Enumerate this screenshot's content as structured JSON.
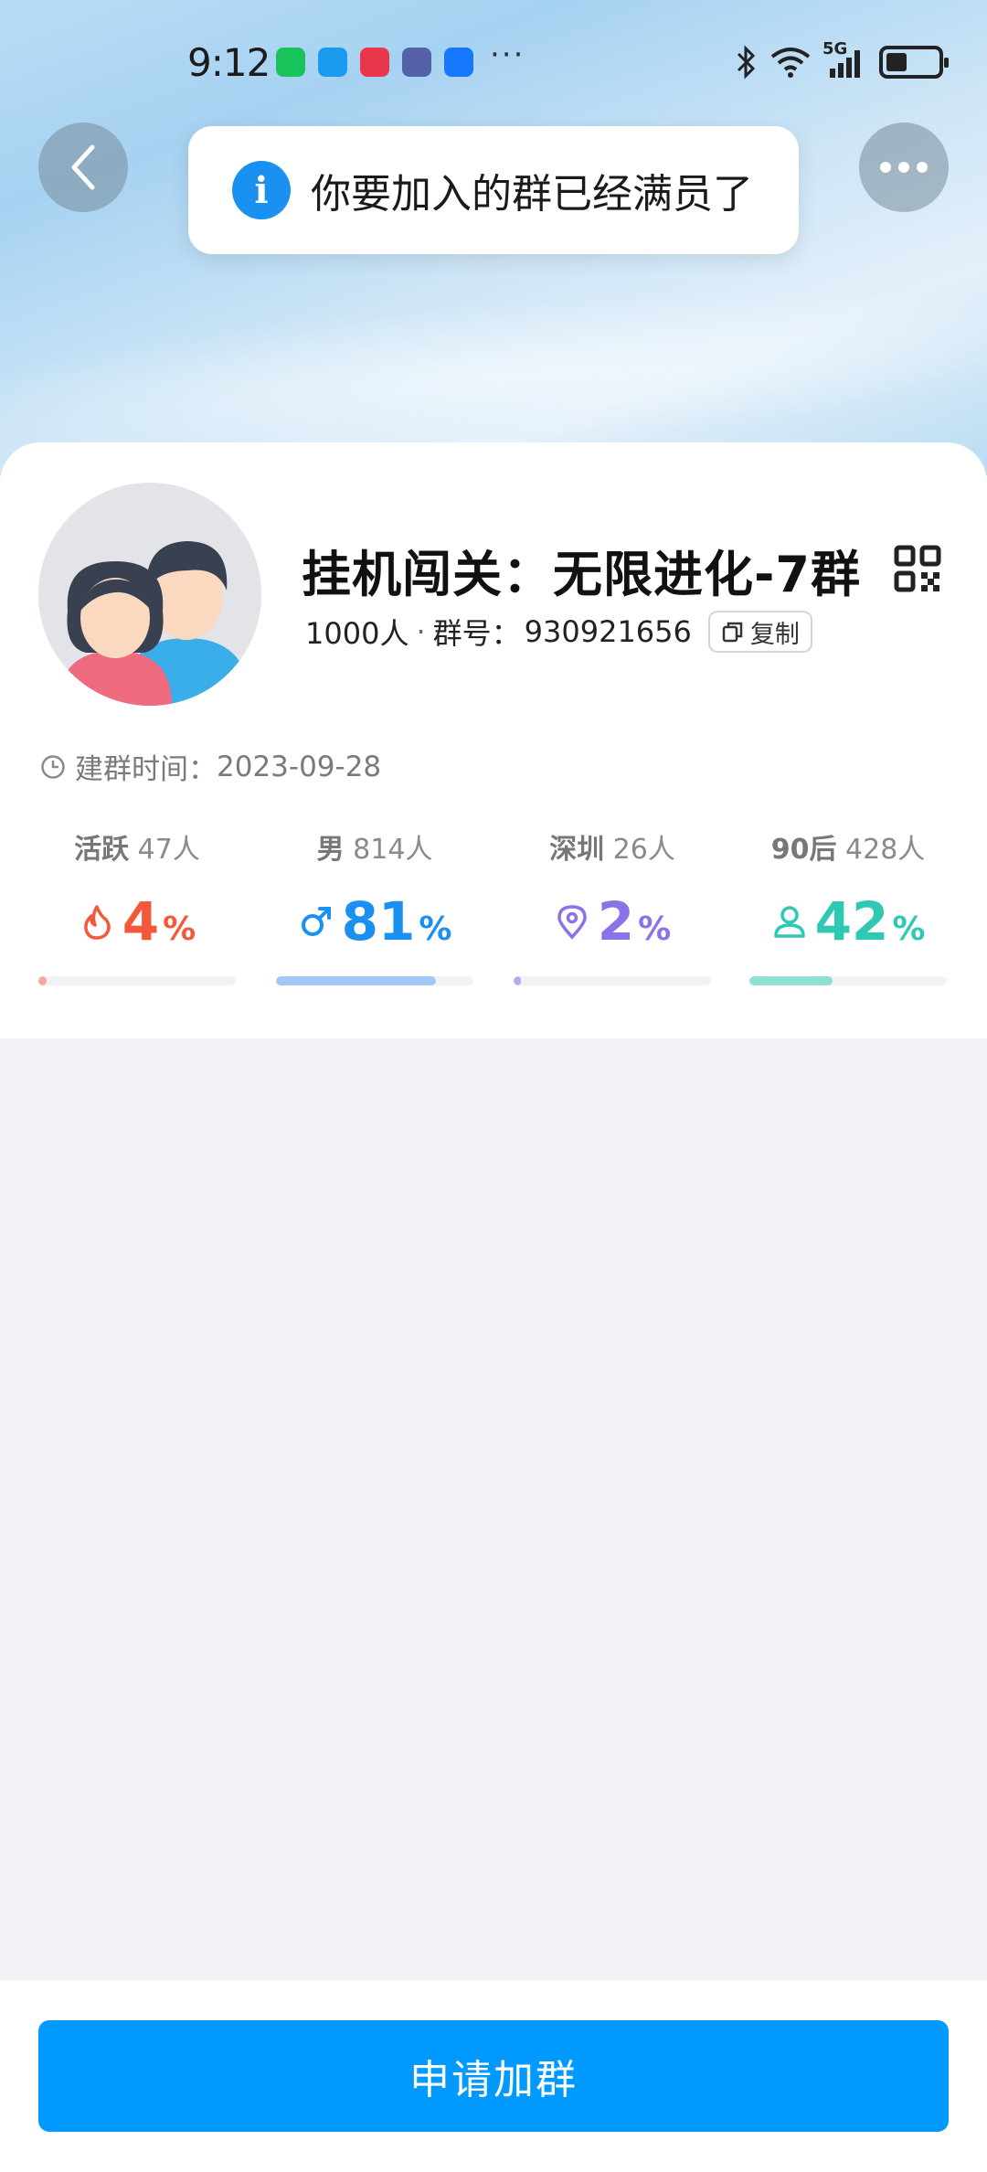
{
  "status_bar": {
    "time": "9:12",
    "dots": "···",
    "network": "5G",
    "app_icons": [
      "wechat-icon",
      "messages-icon",
      "red-app-icon",
      "aqara-icon",
      "alipay-icon"
    ]
  },
  "toast": {
    "message": "你要加入的群已经满员了"
  },
  "group": {
    "name": "挂机闯关：无限进化-7群",
    "members": "1000人",
    "separator": "·",
    "id_label": "群号：",
    "id": "930921656",
    "copy_label": "复制",
    "created_label": "建群时间：",
    "created_date": "2023-09-28"
  },
  "stats": [
    {
      "label": "活跃",
      "count": "47人",
      "value": "4",
      "percent": "%",
      "fraction": 0.04,
      "color": "#f4583a",
      "bar_color": "#f7a89a",
      "icon": "fire-icon"
    },
    {
      "label": "男",
      "count": "814人",
      "value": "81",
      "percent": "%",
      "fraction": 0.81,
      "color": "#1a90f0",
      "bar_color": "#a4c8f5",
      "icon": "male-icon"
    },
    {
      "label": "深圳",
      "count": "26人",
      "value": "2",
      "percent": "%",
      "fraction": 0.02,
      "color": "#8b72e6",
      "bar_color": "#b7a8ef",
      "icon": "location-pin-icon"
    },
    {
      "label": "90后",
      "count": "428人",
      "value": "42",
      "percent": "%",
      "fraction": 0.42,
      "color": "#2fc9b3",
      "bar_color": "#8fe0d2",
      "icon": "person-icon"
    }
  ],
  "apply_button": "申请加群"
}
